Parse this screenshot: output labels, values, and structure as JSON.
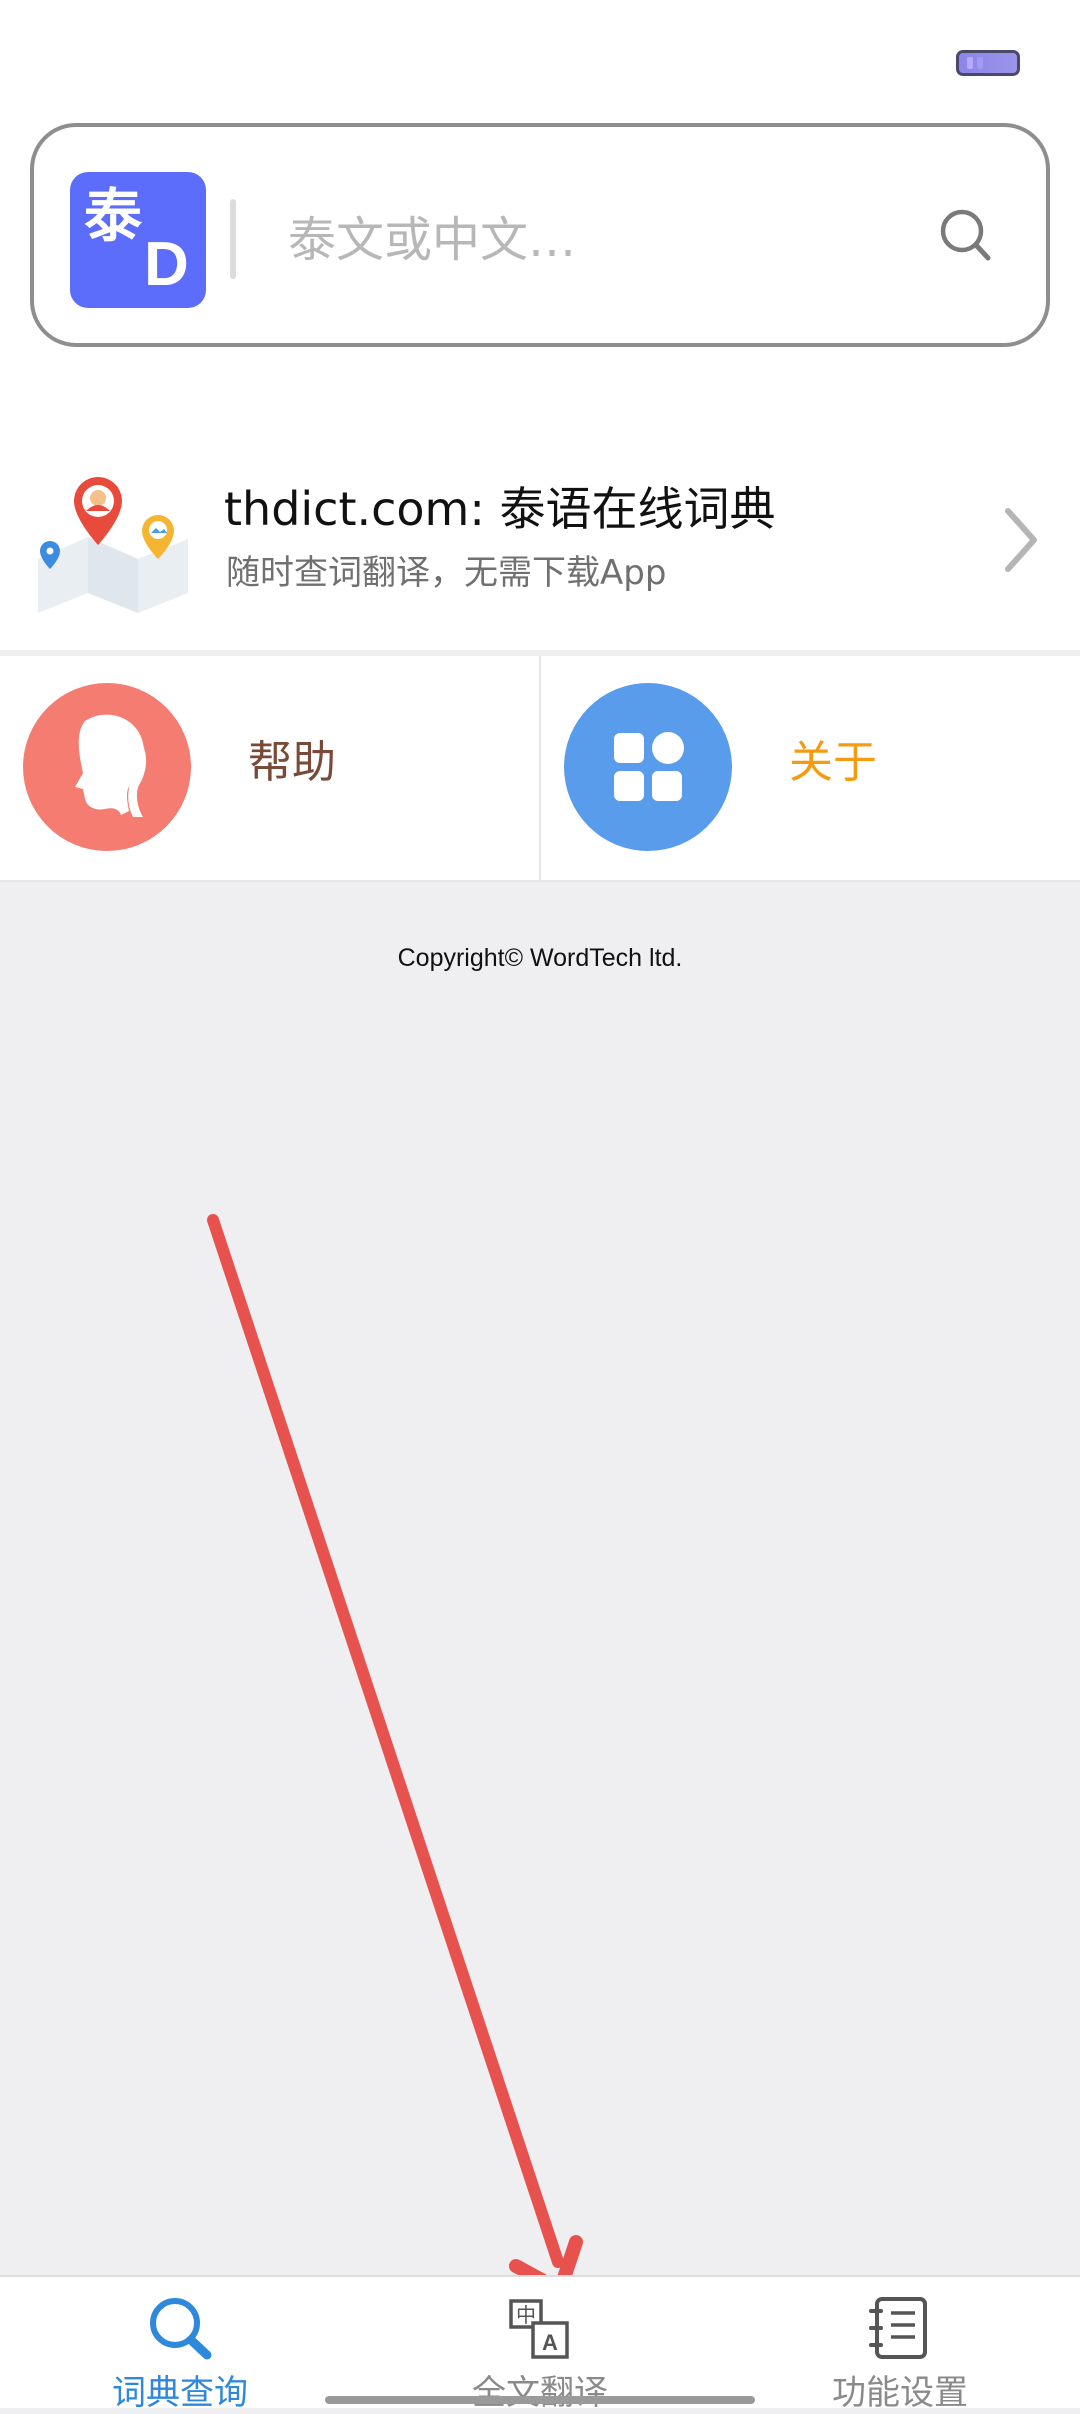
{
  "search": {
    "placeholder": "泰文或中文…"
  },
  "logo": {
    "char": "泰",
    "letter": "D"
  },
  "banner": {
    "title": "thdict.com: 泰语在线词典",
    "subtitle": "随时查词翻译，无需下载App"
  },
  "tiles": [
    {
      "label": "帮助",
      "color": "#f47c70",
      "label_color": "#7a4a38"
    },
    {
      "label": "关于",
      "color": "#5a9cec",
      "label_color": "#f39c12"
    }
  ],
  "copyright": "Copyright© WordTech ltd.",
  "tabs": [
    {
      "label": "词典查询",
      "icon": "search-icon",
      "active": true
    },
    {
      "label": "全文翻译",
      "icon": "translate-icon",
      "active": false
    },
    {
      "label": "功能设置",
      "icon": "notebook-icon",
      "active": false
    }
  ],
  "colors": {
    "accent": "#2e88dc",
    "arrow": "#e8524e",
    "logo_bg": "#5c6cfb"
  }
}
